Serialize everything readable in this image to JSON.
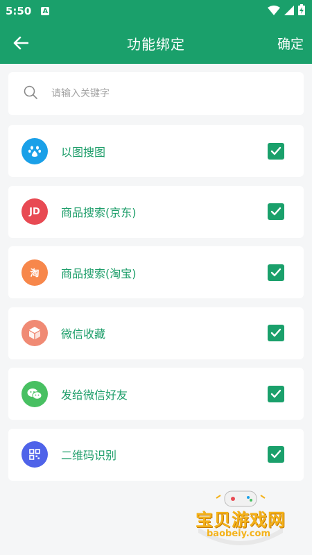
{
  "status_bar": {
    "time": "5:50",
    "notification_badge": "A"
  },
  "app_bar": {
    "title": "功能绑定",
    "confirm_label": "确定",
    "accent": "#1aa06b"
  },
  "search": {
    "placeholder": "请输入关键字",
    "value": ""
  },
  "items": [
    {
      "label": "以图搜图",
      "icon": "baidu-paw-icon",
      "icon_color": "#1aa0e8",
      "checked": true
    },
    {
      "label": "商品搜索(京东)",
      "icon": "jd-icon",
      "icon_text": "JD",
      "icon_color": "#e84a53",
      "checked": true
    },
    {
      "label": "商品搜索(淘宝)",
      "icon": "taobao-icon",
      "icon_text": "淘",
      "icon_color": "#f7874b",
      "checked": true
    },
    {
      "label": "微信收藏",
      "icon": "cube-icon",
      "icon_color": "#f08a74",
      "checked": true
    },
    {
      "label": "发给微信好友",
      "icon": "wechat-icon",
      "icon_color": "#48c062",
      "checked": true
    },
    {
      "label": "二维码识别",
      "icon": "qr-code-icon",
      "icon_color": "#4f63e9",
      "checked": true
    }
  ],
  "watermark": {
    "text": "宝贝游戏网",
    "url": "baobeiy.com"
  }
}
